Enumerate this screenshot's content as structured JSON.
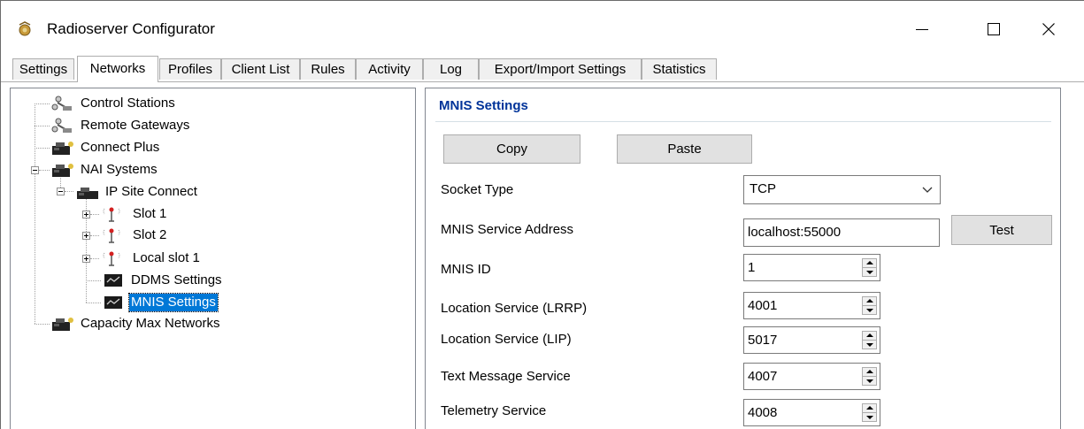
{
  "window": {
    "title": "Radioserver Configurator"
  },
  "tabs": [
    {
      "label": "Settings"
    },
    {
      "label": "Networks",
      "active": true
    },
    {
      "label": "Profiles"
    },
    {
      "label": "Client List"
    },
    {
      "label": "Rules"
    },
    {
      "label": "Activity"
    },
    {
      "label": "Log"
    },
    {
      "label": "Export/Import Settings"
    },
    {
      "label": "Statistics"
    }
  ],
  "tree": {
    "nodes": [
      {
        "label": "Control Stations",
        "icon": "gateway-icon"
      },
      {
        "label": "Remote Gateways",
        "icon": "gateway-icon"
      },
      {
        "label": "Connect Plus",
        "icon": "network-icon"
      },
      {
        "label": "NAI Systems",
        "icon": "network-icon",
        "expanded": true
      },
      {
        "label": "IP Site Connect",
        "icon": "network-icon",
        "expanded": true
      },
      {
        "label": "Slot 1",
        "icon": "antenna-icon",
        "collapsed": true
      },
      {
        "label": "Slot 2",
        "icon": "antenna-icon",
        "collapsed": true
      },
      {
        "label": "Local slot 1",
        "icon": "antenna-icon",
        "collapsed": true
      },
      {
        "label": "DDMS Settings",
        "icon": "settings-monitor-icon"
      },
      {
        "label": "MNIS Settings",
        "icon": "settings-monitor-icon",
        "selected": true
      },
      {
        "label": "Capacity Max Networks",
        "icon": "network-icon"
      }
    ]
  },
  "mnis": {
    "section_title": "MNIS Settings",
    "copy_label": "Copy",
    "paste_label": "Paste",
    "test_label": "Test",
    "fields": {
      "socket_type": {
        "label": "Socket Type",
        "value": "TCP"
      },
      "service_address": {
        "label": "MNIS Service Address",
        "value": "localhost:55000"
      },
      "mnis_id": {
        "label": "MNIS ID",
        "value": "1"
      },
      "lrrp": {
        "label": "Location Service (LRRP)",
        "value": "4001"
      },
      "lip": {
        "label": "Location Service (LIP)",
        "value": "5017"
      },
      "text_message": {
        "label": "Text Message Service",
        "value": "4007"
      },
      "telemetry": {
        "label": "Telemetry Service",
        "value": "4008"
      }
    }
  },
  "colors": {
    "selection": "#0078d7",
    "section_title": "#003399"
  }
}
